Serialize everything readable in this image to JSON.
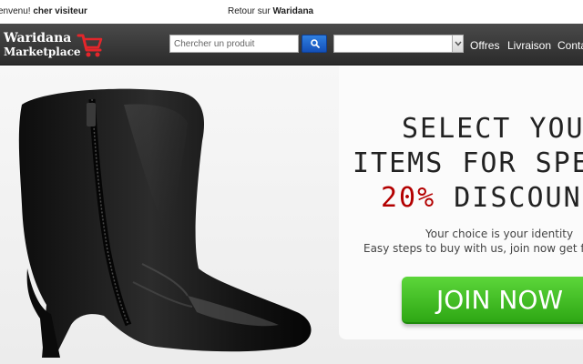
{
  "topbar": {
    "welcome_prefix": "envenu!",
    "welcome_user": "cher visiteur",
    "retour_prefix": "Retour sur",
    "retour_site": "Waridana"
  },
  "navbar": {
    "logo_line1": "Waridana",
    "logo_line2": "Marketplace",
    "search_placeholder": "Chercher un produit",
    "category_select_value": "",
    "links": [
      "Offres",
      "Livraison",
      "Contact"
    ]
  },
  "hero": {
    "headline_line1": "SELECT YOUR",
    "headline_line2": "ITEMS FOR SPEC",
    "discount_percent": "20%",
    "discount_word": "DISCOUN",
    "sub1": "Your choice is your identity",
    "sub2": "Easy steps to buy with us, join now get free",
    "cta_label": "JOIN NOW"
  },
  "colors": {
    "nav_bg": "#333333",
    "search_button": "#1f63cc",
    "discount_red": "#b30000",
    "cta_green": "#3cbb1f",
    "cart_red": "#e3262b"
  },
  "icons": {
    "cart": "shopping-cart-icon",
    "search": "search-icon",
    "select_arrow": "chevron-down-icon"
  }
}
